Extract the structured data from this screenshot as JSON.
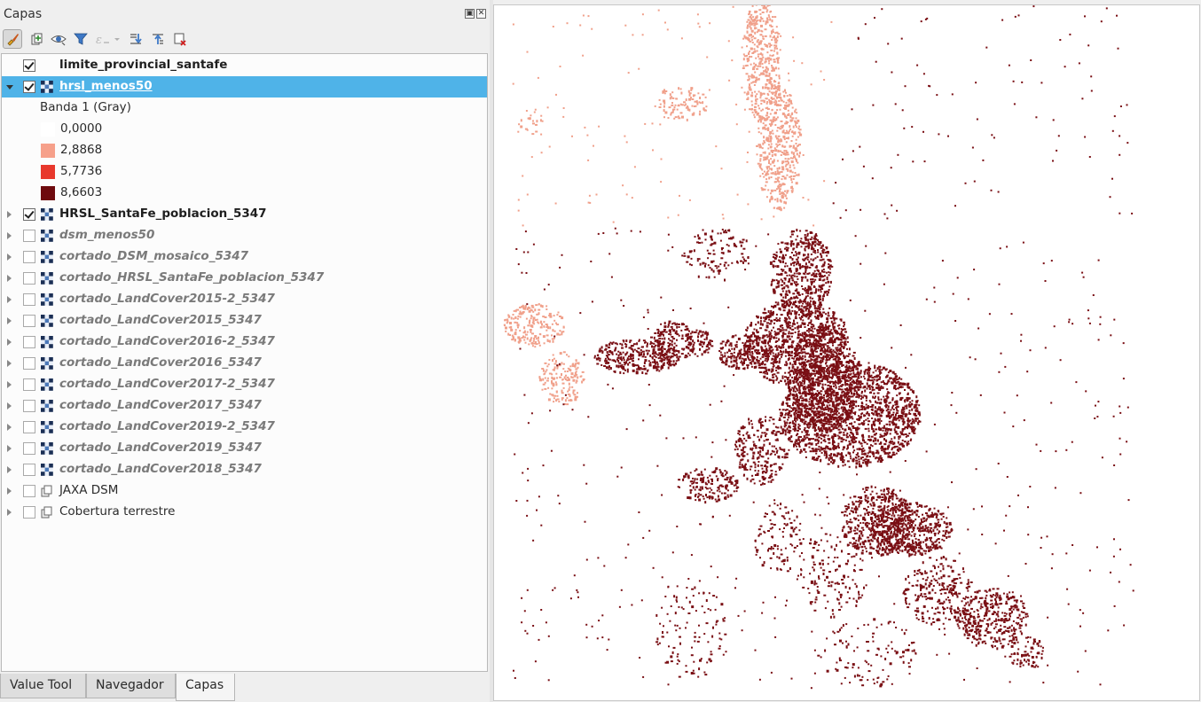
{
  "panel": {
    "title": "Capas",
    "float_icon": "float-icon",
    "close_icon": "close-icon"
  },
  "toolbar": {
    "buttons": [
      {
        "name": "style-manager-button",
        "icon": "paintbrush-icon"
      },
      {
        "name": "add-group-button",
        "icon": "add-group-icon"
      },
      {
        "name": "visibility-button",
        "icon": "eye-icon"
      },
      {
        "name": "filter-legend-button",
        "icon": "filter-icon"
      },
      {
        "name": "filter-expression-button",
        "icon": "expression-filter-icon"
      },
      {
        "name": "expand-all-button",
        "icon": "expand-all-icon"
      },
      {
        "name": "collapse-all-button",
        "icon": "collapse-all-icon"
      },
      {
        "name": "remove-layer-button",
        "icon": "remove-layer-icon"
      }
    ]
  },
  "layers": [
    {
      "label": "limite_provincial_santafe",
      "checked": true,
      "style": "bold",
      "icon": "vector-polygon-icon",
      "expandable": false
    },
    {
      "label": "hrsl_menos50",
      "checked": true,
      "style": "selected",
      "icon": "raster-icon",
      "expandable": true,
      "expanded": true
    },
    {
      "label": "HRSL_SantaFe_poblacion_5347",
      "checked": true,
      "style": "bold",
      "icon": "raster-icon",
      "expandable": true
    },
    {
      "label": "dsm_menos50",
      "checked": false,
      "style": "off",
      "icon": "raster-icon",
      "expandable": true
    },
    {
      "label": "cortado_DSM_mosaico_5347",
      "checked": false,
      "style": "off",
      "icon": "raster-icon",
      "expandable": true
    },
    {
      "label": "cortado_HRSL_SantaFe_poblacion_5347",
      "checked": false,
      "style": "off",
      "icon": "raster-icon",
      "expandable": true
    },
    {
      "label": "cortado_LandCover2015-2_5347",
      "checked": false,
      "style": "off",
      "icon": "raster-icon",
      "expandable": true
    },
    {
      "label": "cortado_LandCover2015_5347",
      "checked": false,
      "style": "off",
      "icon": "raster-icon",
      "expandable": true
    },
    {
      "label": "cortado_LandCover2016-2_5347",
      "checked": false,
      "style": "off",
      "icon": "raster-icon",
      "expandable": true
    },
    {
      "label": "cortado_LandCover2016_5347",
      "checked": false,
      "style": "off",
      "icon": "raster-icon",
      "expandable": true
    },
    {
      "label": "cortado_LandCover2017-2_5347",
      "checked": false,
      "style": "off",
      "icon": "raster-icon",
      "expandable": true
    },
    {
      "label": "cortado_LandCover2017_5347",
      "checked": false,
      "style": "off",
      "icon": "raster-icon",
      "expandable": true
    },
    {
      "label": "cortado_LandCover2019-2_5347",
      "checked": false,
      "style": "off",
      "icon": "raster-icon",
      "expandable": true
    },
    {
      "label": "cortado_LandCover2019_5347",
      "checked": false,
      "style": "off",
      "icon": "raster-icon",
      "expandable": true
    },
    {
      "label": "cortado_LandCover2018_5347",
      "checked": false,
      "style": "off",
      "icon": "raster-icon",
      "expandable": true
    },
    {
      "label": "JAXA DSM",
      "checked": false,
      "style": "normal",
      "icon": "group-icon",
      "expandable": true
    },
    {
      "label": "Cobertura terrestre",
      "checked": false,
      "style": "normal",
      "icon": "group-icon",
      "expandable": true
    }
  ],
  "legend": {
    "band": "Banda 1 (Gray)",
    "entries": [
      {
        "value": "0,0000",
        "color": "#ffffff"
      },
      {
        "value": "2,8868",
        "color": "#f6a08a"
      },
      {
        "value": "5,7736",
        "color": "#e8382c"
      },
      {
        "value": "8,6603",
        "color": "#6e0a0e"
      }
    ]
  },
  "tabs": [
    {
      "label": "Value Tool",
      "active": false
    },
    {
      "label": "Navegador",
      "active": false
    },
    {
      "label": "Capas",
      "active": true
    }
  ],
  "map": {
    "background": "#ffffff",
    "colors": {
      "light": "#f0a08a",
      "dark": "#7a0f14"
    }
  }
}
